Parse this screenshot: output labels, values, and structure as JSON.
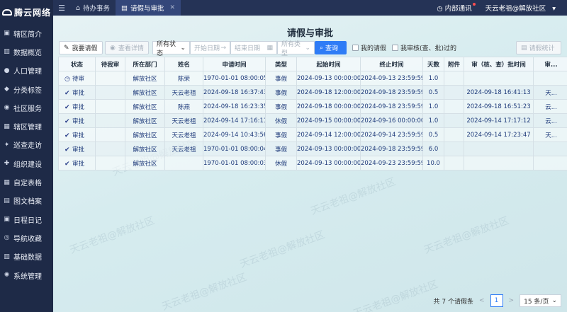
{
  "app": {
    "logo_text": "腾云网络"
  },
  "sidebar": {
    "items": [
      {
        "label": "辖区简介",
        "icon": "building-icon"
      },
      {
        "label": "数据概览",
        "icon": "chart-icon"
      },
      {
        "label": "人口管理",
        "icon": "person-icon"
      },
      {
        "label": "分类标签",
        "icon": "tag-icon"
      },
      {
        "label": "社区服务",
        "icon": "service-icon"
      },
      {
        "label": "辖区管理",
        "icon": "map-icon"
      },
      {
        "label": "巡查走访",
        "icon": "patrol-icon"
      },
      {
        "label": "组织建设",
        "icon": "org-icon"
      },
      {
        "label": "自定表格",
        "icon": "table-icon"
      },
      {
        "label": "图文档案",
        "icon": "archive-icon"
      },
      {
        "label": "日程日记",
        "icon": "calendar-icon"
      },
      {
        "label": "导航收藏",
        "icon": "compass-icon"
      },
      {
        "label": "基础数据",
        "icon": "database-icon"
      },
      {
        "label": "系统管理",
        "icon": "gear-icon"
      }
    ]
  },
  "topbar": {
    "tabs": [
      {
        "label": "待办事务",
        "icon": "home-icon",
        "active": false
      },
      {
        "label": "请假与审批",
        "icon": "document-icon",
        "active": true
      }
    ],
    "notify_label": "内部通讯",
    "user_label": "天云老祖@解放社区"
  },
  "page": {
    "title": "请假与审批"
  },
  "toolbar": {
    "new_leave_label": "我要请假",
    "view_detail_label": "查看详情",
    "status_select": "所有状态",
    "start_date_placeholder": "开始日期",
    "end_date_placeholder": "结束日期",
    "date_sep": "→",
    "type_select": "所有类型",
    "search_label": "查询",
    "my_leave_label": "我的请假",
    "my_approval_label": "我审核(查、批)过的",
    "stats_label": "请假统计"
  },
  "table": {
    "headers": [
      "状态",
      "待我审",
      "所在部门",
      "姓名",
      "申请时间",
      "类型",
      "起始时间",
      "终止时间",
      "天数",
      "附件",
      "审（核、查）批时间",
      "审..."
    ],
    "rows": [
      {
        "status": "待审",
        "status_icon": "clock-icon",
        "mine": "",
        "dept": "解放社区",
        "name": "陈荣",
        "apply": "1970-01-01 08:00:05",
        "type": "事假",
        "start": "2024-09-13 00:00:00",
        "end": "2024-09-13 23:59:59",
        "days": "1.0",
        "attach": "",
        "approve_time": "",
        "approver": ""
      },
      {
        "status": "审批",
        "status_icon": "check-icon",
        "mine": "",
        "dept": "解放社区",
        "name": "天云老祖",
        "apply": "2024-09-18 16:37:43",
        "type": "事假",
        "start": "2024-09-18 12:00:00",
        "end": "2024-09-18 23:59:59",
        "days": "0.5",
        "attach": "",
        "approve_time": "2024-09-18 16:41:13",
        "approver": "天..."
      },
      {
        "status": "审批",
        "status_icon": "check-icon",
        "mine": "",
        "dept": "解放社区",
        "name": "陈燕",
        "apply": "2024-09-18 16:23:35",
        "type": "事假",
        "start": "2024-09-18 00:00:00",
        "end": "2024-09-18 23:59:59",
        "days": "1.0",
        "attach": "",
        "approve_time": "2024-09-18 16:51:23",
        "approver": "云..."
      },
      {
        "status": "审批",
        "status_icon": "check-icon",
        "mine": "",
        "dept": "解放社区",
        "name": "天云老祖",
        "apply": "2024-09-14 17:16:11",
        "type": "休假",
        "start": "2024-09-15 00:00:00",
        "end": "2024-09-16 00:00:00",
        "days": "1.0",
        "attach": "",
        "approve_time": "2024-09-14 17:17:12",
        "approver": "云..."
      },
      {
        "status": "审批",
        "status_icon": "check-icon",
        "mine": "",
        "dept": "解放社区",
        "name": "天云老祖",
        "apply": "2024-09-14 10:43:56",
        "type": "事假",
        "start": "2024-09-14 12:00:00",
        "end": "2024-09-14 23:59:59",
        "days": "0.5",
        "attach": "",
        "approve_time": "2024-09-14 17:23:47",
        "approver": "天..."
      },
      {
        "status": "审批",
        "status_icon": "check-icon",
        "mine": "",
        "dept": "解放社区",
        "name": "天云老祖",
        "apply": "1970-01-01 08:00:04",
        "type": "事假",
        "start": "2024-09-13 00:00:00",
        "end": "2024-09-18 23:59:59",
        "days": "6.0",
        "attach": "",
        "approve_time": "",
        "approver": ""
      },
      {
        "status": "审批",
        "status_icon": "check-icon",
        "mine": "",
        "dept": "解放社区",
        "name": "",
        "apply": "1970-01-01 08:00:03",
        "type": "休假",
        "start": "2024-09-13 00:00:00",
        "end": "2024-09-23 23:59:59",
        "days": "10.0",
        "attach": "",
        "approve_time": "",
        "approver": ""
      }
    ]
  },
  "pager": {
    "total_label": "共 7 个请假条",
    "prev": "<",
    "page": "1",
    "next": ">",
    "per_page": "15 条/页"
  },
  "watermark": "天云老祖@解放社区",
  "colors": {
    "sidebar_bg": "#1e2a47",
    "topbar_bg": "#253356",
    "primary": "#2f7cf6",
    "text_blue": "#1e3a7a"
  }
}
